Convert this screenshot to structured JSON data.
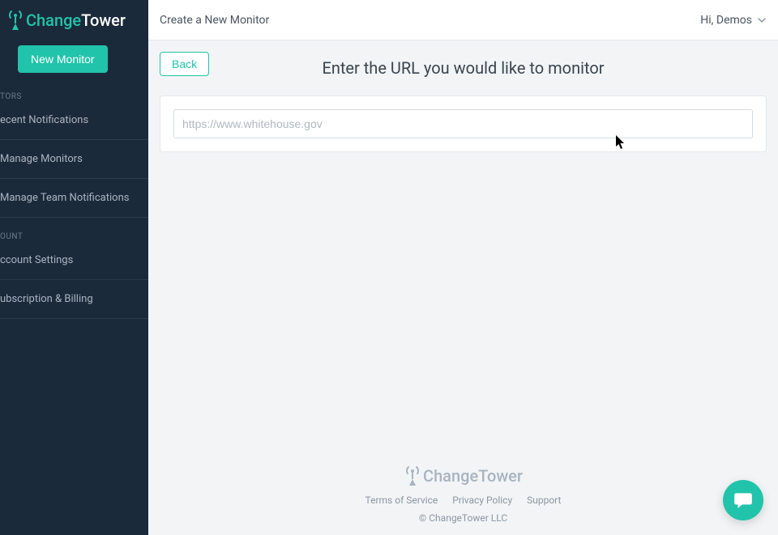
{
  "brand": {
    "change": "Change",
    "tower": "Tower"
  },
  "sidebar": {
    "newMonitor": "New Monitor",
    "sections": [
      {
        "label": "TORS",
        "items": [
          "ecent Notifications",
          "Manage Monitors",
          "Manage Team Notifications"
        ]
      },
      {
        "label": "OUNT",
        "items": [
          "ccount Settings",
          "ubscription & Billing"
        ]
      }
    ]
  },
  "topbar": {
    "title": "Create a New Monitor",
    "greeting": "Hi, Demos"
  },
  "page": {
    "back": "Back",
    "heading": "Enter the URL you would like to monitor",
    "placeholder": "https://www.whitehouse.gov"
  },
  "footer": {
    "links": [
      "Terms of Service",
      "Privacy Policy",
      "Support"
    ],
    "copyright": "© ChangeTower LLC"
  }
}
